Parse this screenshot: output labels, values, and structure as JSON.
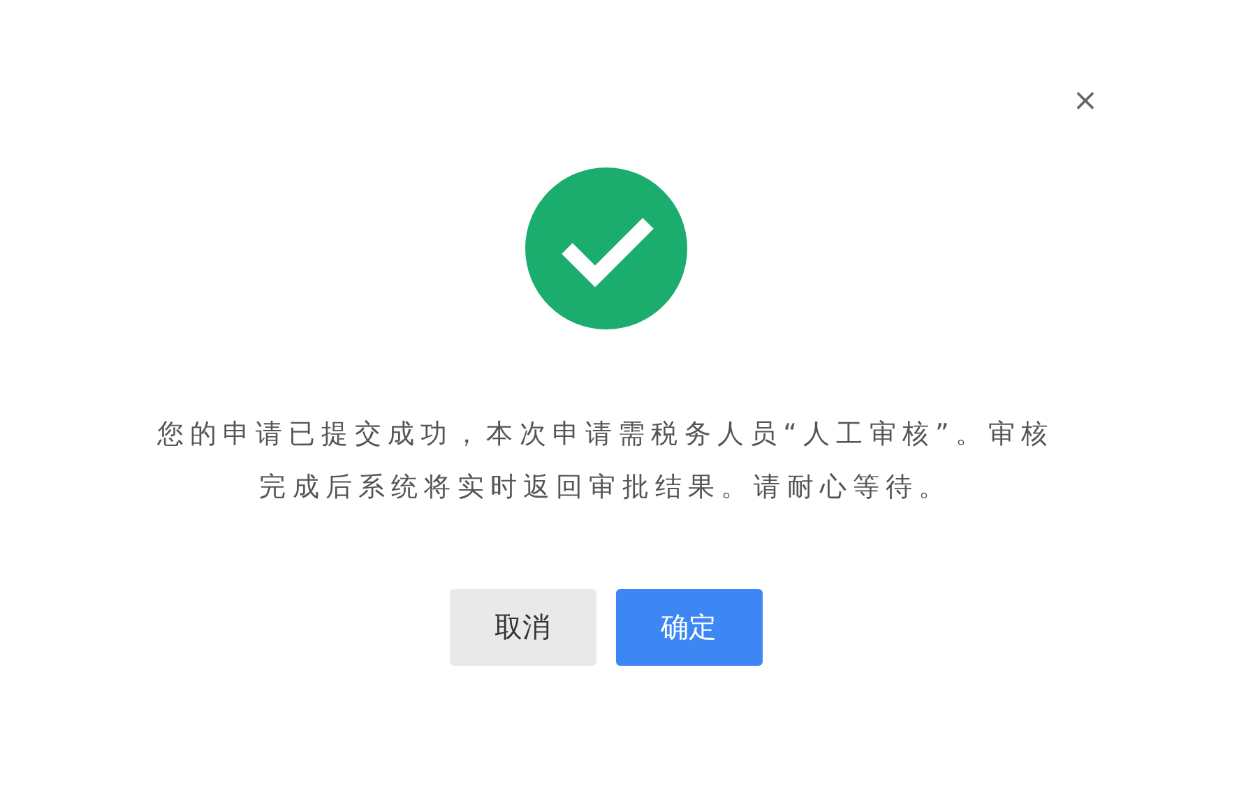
{
  "dialog": {
    "close": "×",
    "message": "您的申请已提交成功，本次申请需税务人员“人工审核”。审核完成后系统将实时返回审批结果。请耐心等待。",
    "buttons": [
      {
        "label": "取消",
        "kind": "secondary"
      },
      {
        "label": "确定",
        "kind": "primary"
      }
    ]
  }
}
